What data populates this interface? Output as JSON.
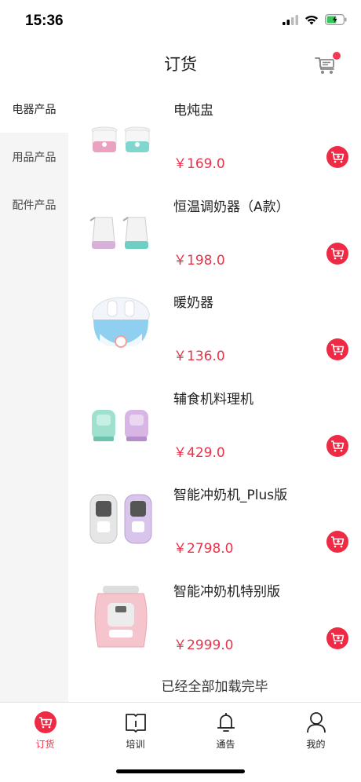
{
  "status_bar": {
    "time": "15:36"
  },
  "header": {
    "title": "订货"
  },
  "sidebar": {
    "items": [
      {
        "label": "电器产品",
        "active": true
      },
      {
        "label": "用品产品",
        "active": false
      },
      {
        "label": "配件产品",
        "active": false
      }
    ]
  },
  "products": [
    {
      "name": "电炖盅",
      "price": "￥169.0"
    },
    {
      "name": "恒温调奶器（A款）",
      "price": "￥198.0"
    },
    {
      "name": "暖奶器",
      "price": "￥136.0"
    },
    {
      "name": "辅食机料理机",
      "price": "￥429.0"
    },
    {
      "name": "智能冲奶机_Plus版",
      "price": "￥2798.0"
    },
    {
      "name": "智能冲奶机特别版",
      "price": "￥2999.0"
    }
  ],
  "footer_text": "已经全部加载完毕",
  "tabbar": {
    "tabs": [
      {
        "label": "订货",
        "icon": "cart-icon",
        "active": true
      },
      {
        "label": "培训",
        "icon": "book-icon",
        "active": false
      },
      {
        "label": "通告",
        "icon": "bell-icon",
        "active": false
      },
      {
        "label": "我的",
        "icon": "user-icon",
        "active": false
      }
    ]
  },
  "colors": {
    "accent": "#e8334a",
    "sidebar_bg": "#f5f5f5"
  }
}
